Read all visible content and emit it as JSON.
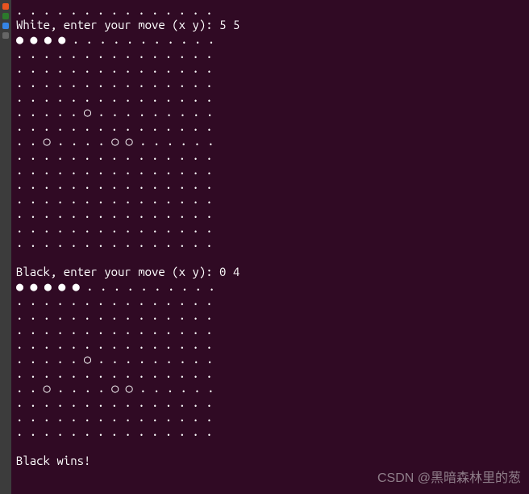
{
  "glyphs": {
    "empty": ".",
    "black": "●",
    "white": "○"
  },
  "turn1": {
    "prompt_prefix": "White, enter your move (x y): ",
    "input": "5 5",
    "rows": 15,
    "cols": 15,
    "black_stones": [
      [
        0,
        0
      ],
      [
        0,
        1
      ],
      [
        0,
        2
      ],
      [
        0,
        3
      ]
    ],
    "white_stones": [
      [
        5,
        5
      ],
      [
        7,
        2
      ],
      [
        7,
        7
      ],
      [
        7,
        8
      ]
    ]
  },
  "turn2": {
    "prompt_prefix": "Black, enter your move (x y): ",
    "input": "0 4",
    "rows": 11,
    "cols": 15,
    "black_stones": [
      [
        0,
        0
      ],
      [
        0,
        1
      ],
      [
        0,
        2
      ],
      [
        0,
        3
      ],
      [
        0,
        4
      ]
    ],
    "white_stones": [
      [
        5,
        5
      ],
      [
        7,
        2
      ],
      [
        7,
        7
      ],
      [
        7,
        8
      ]
    ]
  },
  "result": "Black wins!",
  "watermark": "CSDN @黑暗森林里的葱",
  "launcher_colors": [
    "#e95420",
    "#2c7a2c",
    "#3584e4",
    "#666666"
  ]
}
